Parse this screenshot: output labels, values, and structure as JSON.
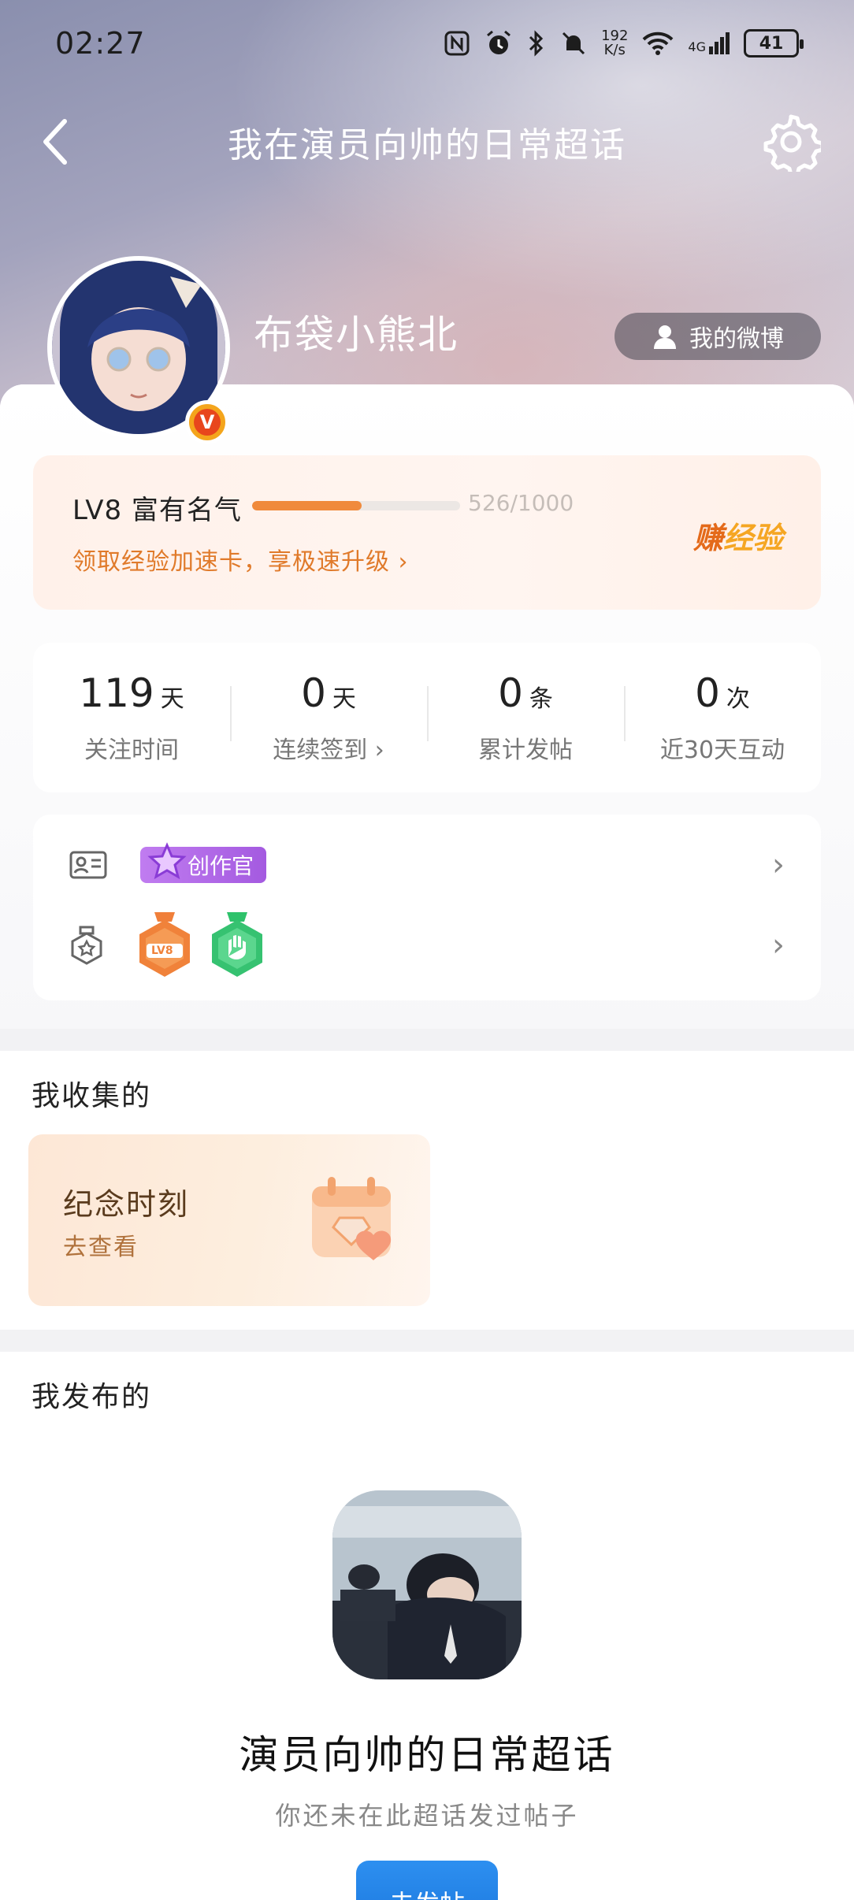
{
  "status_bar": {
    "time": "02:27",
    "net_speed_value": "192",
    "net_speed_unit": "K/s",
    "signal_label": "4G",
    "battery": "41"
  },
  "nav": {
    "title": "我在演员向帅的日常超话",
    "back_icon": "chevron-left-icon",
    "settings_icon": "gear-icon"
  },
  "profile": {
    "username": "布袋小熊北",
    "verified_badge": "V",
    "my_weibo_label": "我的微博"
  },
  "level": {
    "name": "LV8 富有名气",
    "progress_text": "526/1000",
    "progress_fraction": 0.526,
    "speedup_text": "领取经验加速卡，享极速升级 ›",
    "earn_part1": "赚",
    "earn_part2": "经验"
  },
  "stats": [
    {
      "num": "119",
      "unit": "天",
      "label": "关注时间"
    },
    {
      "num": "0",
      "unit": "天",
      "label": "连续签到 ›"
    },
    {
      "num": "0",
      "unit": "条",
      "label": "累计发帖"
    },
    {
      "num": "0",
      "unit": "次",
      "label": "近30天互动"
    }
  ],
  "badges": {
    "creator_label": "创作官",
    "medal_lv_text": "LV8"
  },
  "collected": {
    "section_title": "我收集的",
    "card_title": "纪念时刻",
    "card_action": "去查看"
  },
  "published": {
    "section_title": "我发布的",
    "super_topic_name": "演员向帅的日常超话",
    "empty_text": "你还未在此超话发过帖子",
    "post_button": "去发帖"
  },
  "colors": {
    "accent_orange": "#e07a2a",
    "progress_fill": "#f08a3c",
    "creator_purple": "#a45ae0",
    "post_blue": "#1e7be0"
  }
}
